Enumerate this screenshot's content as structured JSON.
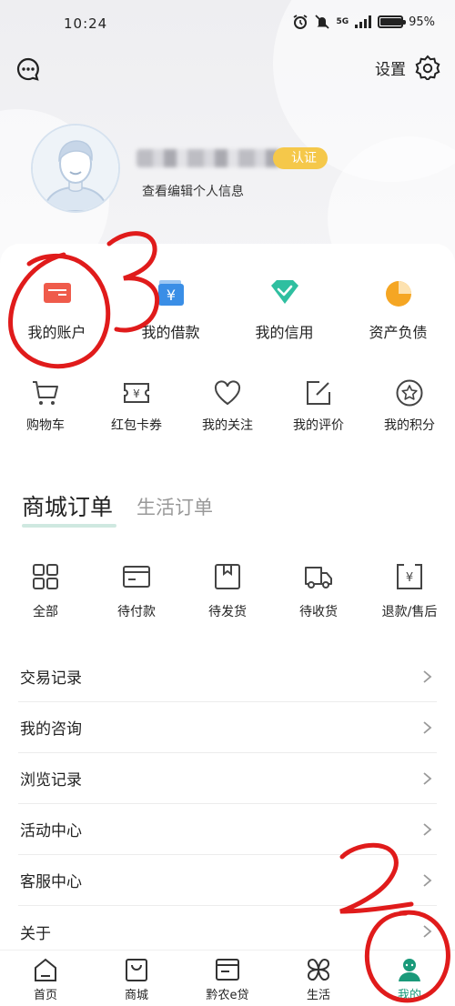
{
  "status_bar": {
    "time": "10:24",
    "network": "5G",
    "battery_percent": "95%",
    "battery_level": 0.95
  },
  "top_bar": {
    "message_icon": "chat-bubble-icon",
    "settings_label": "设置",
    "settings_icon": "gear-icon"
  },
  "profile": {
    "certified_badge": "认证",
    "edit_info": "查看编辑个人信息"
  },
  "quick_actions": [
    {
      "label": "我的账户",
      "icon": "card-icon",
      "color": "#ef5b4b"
    },
    {
      "label": "我的借款",
      "icon": "wallet-icon",
      "color": "#3a8ee6"
    },
    {
      "label": "我的信用",
      "icon": "diamond-icon",
      "color": "#2fbfa0"
    },
    {
      "label": "资产负债",
      "icon": "pie-icon",
      "color": "#f5a623"
    }
  ],
  "tools": [
    {
      "label": "购物车",
      "icon": "cart-icon"
    },
    {
      "label": "红包卡券",
      "icon": "coupon-icon"
    },
    {
      "label": "我的关注",
      "icon": "heart-icon"
    },
    {
      "label": "我的评价",
      "icon": "edit-icon"
    },
    {
      "label": "我的积分",
      "icon": "star-icon"
    }
  ],
  "order_tabs": {
    "active": "商城订单",
    "inactive": "生活订单"
  },
  "orders": [
    {
      "label": "全部",
      "icon": "grid-icon"
    },
    {
      "label": "待付款",
      "icon": "payment-card-icon"
    },
    {
      "label": "待发货",
      "icon": "box-icon"
    },
    {
      "label": "待收货",
      "icon": "truck-icon"
    },
    {
      "label": "退款/售后",
      "icon": "refund-icon"
    }
  ],
  "menu": [
    {
      "label": "交易记录"
    },
    {
      "label": "我的咨询"
    },
    {
      "label": "浏览记录"
    },
    {
      "label": "活动中心"
    },
    {
      "label": "客服中心"
    },
    {
      "label": "关于"
    }
  ],
  "bottom_nav": [
    {
      "label": "首页",
      "icon": "home-icon"
    },
    {
      "label": "商城",
      "icon": "shopping-bag-icon"
    },
    {
      "label": "黔农e贷",
      "icon": "loan-icon"
    },
    {
      "label": "生活",
      "icon": "life-icon"
    },
    {
      "label": "我的",
      "icon": "profile-icon",
      "active": true
    }
  ],
  "colors": {
    "accent_green": "#1a9a7a",
    "annotation_red": "#e01b1b"
  }
}
